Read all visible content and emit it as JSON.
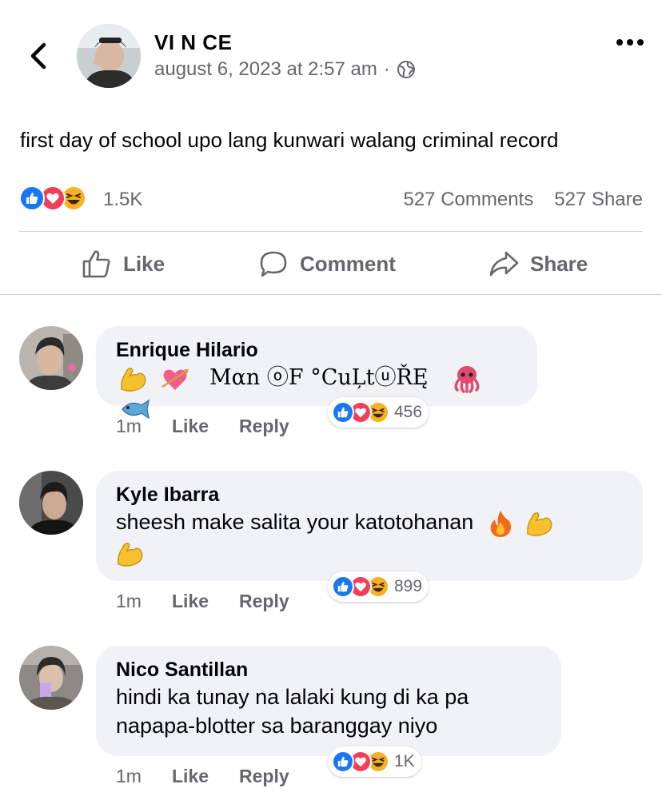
{
  "post": {
    "author": "VI N CE",
    "timestamp": "august 6, 2023 at 2:57 am",
    "meta_separator": "·",
    "audience_icon": "globe-icon",
    "text": "first day of school upo lang kunwari walang criminal record",
    "reactions_count": "1.5K",
    "comments_count": "527 Comments",
    "shares_count": "527 Share"
  },
  "actions": {
    "like": "Like",
    "comment": "Comment",
    "share": "Share"
  },
  "comments": [
    {
      "name": "Enrique Hilario",
      "text": "Mαn ⓞF °CuĻtⓤŘĘ",
      "emojis_before": [
        "flexed-biceps",
        "heart-with-arrow"
      ],
      "emojis_after": [
        "octopus",
        "fish"
      ],
      "reactions_count": "456",
      "time": "1m",
      "like": "Like",
      "reply": "Reply"
    },
    {
      "name": "Kyle Ibarra",
      "text_line1": "sheesh make salita your katotohanan",
      "emojis_line1": [
        "fire",
        "flexed-biceps"
      ],
      "emojis_line2": [
        "flexed-biceps"
      ],
      "reactions_count": "899",
      "time": "1m",
      "like": "Like",
      "reply": "Reply"
    },
    {
      "name": "Nico Santillan",
      "text_line1": "hindi ka tunay na lalaki kung di ka pa",
      "text_line2": "napapa-blotter sa baranggay niyo",
      "reactions_count": "1K",
      "time": "1m",
      "like": "Like",
      "reply": "Reply"
    }
  ],
  "colors": {
    "like_blue": "#1877f2",
    "love_red": "#f33e58",
    "haha_yellow": "#f7b125",
    "secondary_text": "#65676b",
    "bubble_bg": "#f0f2f5"
  }
}
